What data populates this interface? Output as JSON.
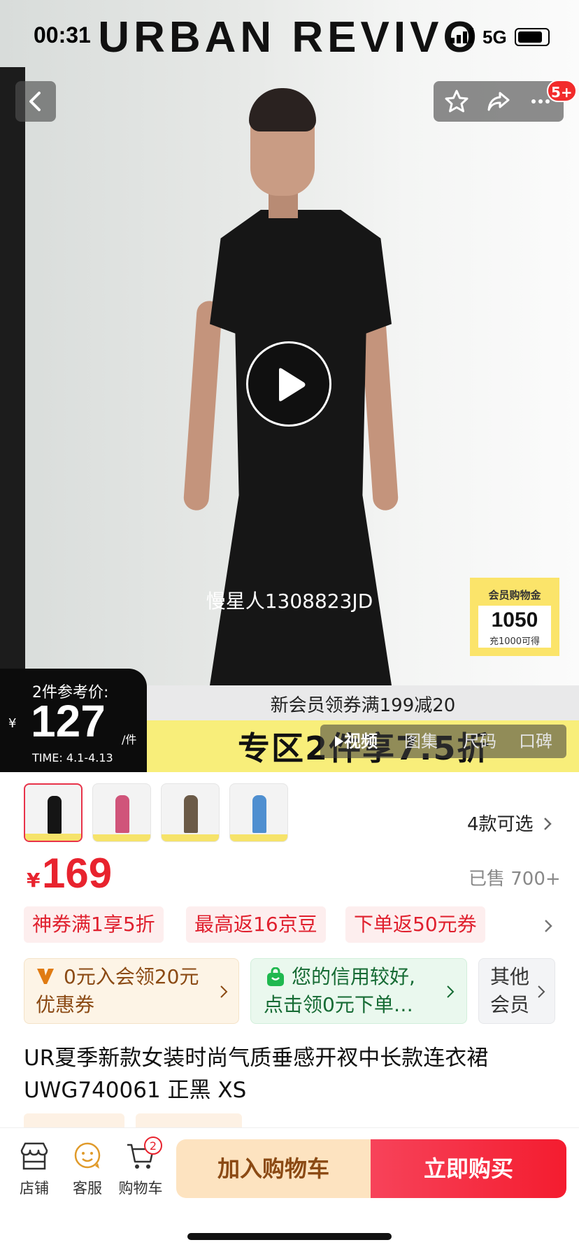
{
  "status_bar": {
    "time": "00:31",
    "network": "5G"
  },
  "brand": "URBAN REVIVO",
  "top_bar": {
    "badge": "5+"
  },
  "video": {
    "watermark": "慢星人1308823JD"
  },
  "member_card": {
    "title": "会员购物金",
    "amount": "1050",
    "sub": "充1000可得"
  },
  "promo": {
    "line1": "新会员领券满199减20",
    "line2": "专区2件享7.5折"
  },
  "ref_price": {
    "label": "2件参考价:",
    "currency": "¥",
    "value": "127",
    "unit": "/件",
    "time": "TIME: 4.1-4.13"
  },
  "media_tabs": [
    "视频",
    "图集",
    "尺码",
    "口碑"
  ],
  "variants": {
    "count_label": "4款可选",
    "colors": [
      "#151515",
      "#d0547a",
      "#6b5a47",
      "#4f8fd0"
    ]
  },
  "price": {
    "currency": "¥",
    "value": "169",
    "sold": "已售 700+"
  },
  "promo_tags": [
    "神券满1享5折",
    "最高返16京豆",
    "下单返50元券"
  ],
  "benefit_cards": [
    {
      "line1": "0元入会领20元",
      "line2": "优惠券"
    },
    {
      "line1": "您的信用较好,",
      "line2": "点击领0元下单…"
    },
    {
      "line1": "其他",
      "line2": "会员"
    }
  ],
  "product_title": "UR夏季新款女装时尚气质垂感开衩中长款连衣裙UWG740061 正黑 XS",
  "bottom_bar": {
    "shop": "店铺",
    "service": "客服",
    "cart": "购物车",
    "cart_count": "2",
    "add_to_cart": "加入购物车",
    "buy_now": "立即购买"
  },
  "colors": {
    "accent_red": "#e8232e",
    "buy_button": "#f41c2f",
    "cart_button": "#fde3c0"
  }
}
